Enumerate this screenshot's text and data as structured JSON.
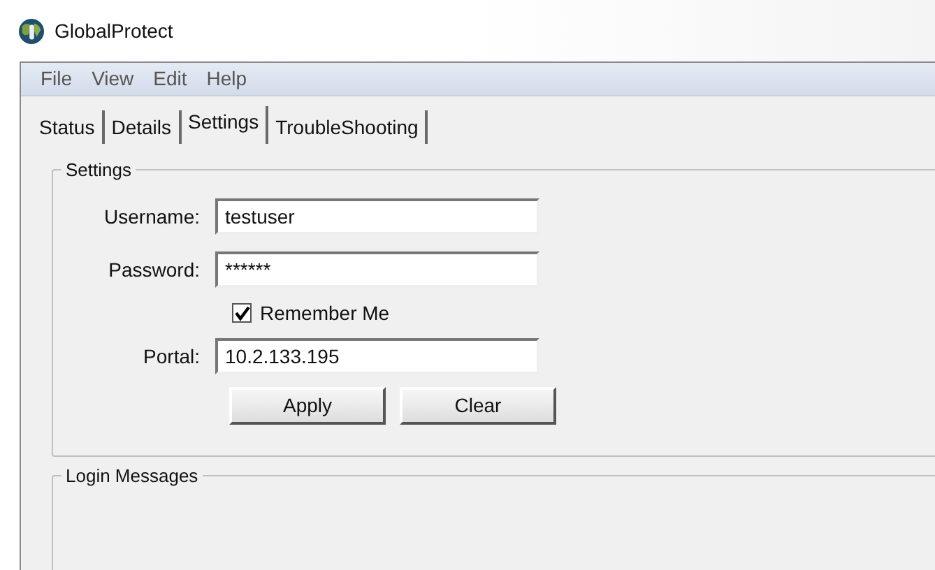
{
  "window": {
    "title": "GlobalProtect"
  },
  "menu": [
    "File",
    "View",
    "Edit",
    "Help"
  ],
  "tabs": [
    {
      "label": "Status",
      "selected": false
    },
    {
      "label": "Details",
      "selected": false
    },
    {
      "label": "Settings",
      "selected": true
    },
    {
      "label": "TroubleShooting",
      "selected": false
    }
  ],
  "settings": {
    "title": "Settings",
    "fields": [
      {
        "kind": "text",
        "label": "Username:",
        "value": "testuser"
      },
      {
        "kind": "text",
        "label": "Password:",
        "value": "******"
      },
      {
        "kind": "checkbox",
        "label": "Remember Me",
        "checked": true
      },
      {
        "kind": "text",
        "label": "Portal:",
        "value": "10.2.133.195"
      }
    ],
    "buttons": [
      "Apply",
      "Clear"
    ]
  },
  "login_messages": {
    "title": "Login Messages"
  }
}
